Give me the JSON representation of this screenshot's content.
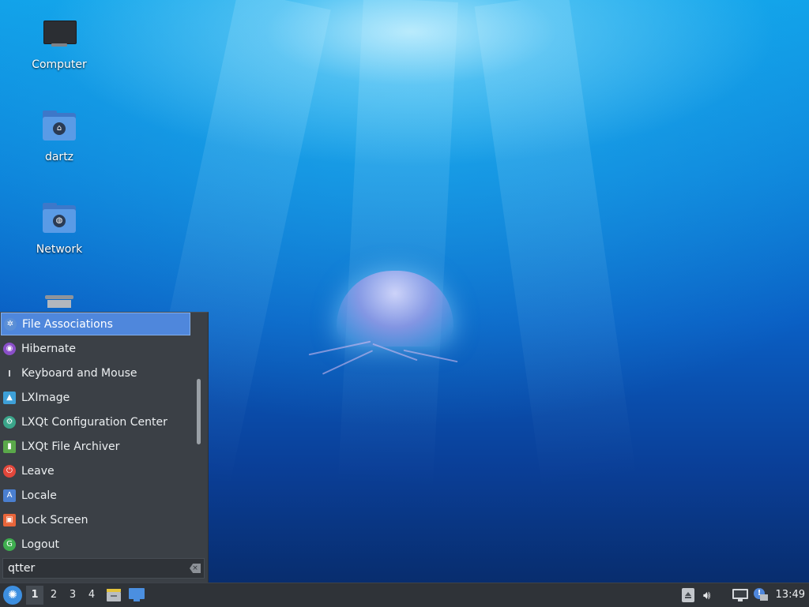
{
  "desktop": {
    "icons": [
      {
        "label": "Computer",
        "icon": "computer-icon"
      },
      {
        "label": "dartz",
        "icon": "home-folder-icon"
      },
      {
        "label": "Network",
        "icon": "network-folder-icon"
      },
      {
        "label": "",
        "icon": "trash-icon"
      }
    ]
  },
  "menu": {
    "items": [
      {
        "label": "File Associations",
        "icon": "file-associations-icon",
        "color": "#5b8fd6"
      },
      {
        "label": "Hibernate",
        "icon": "hibernate-icon",
        "color": "#8a4fc9"
      },
      {
        "label": "Keyboard and Mouse",
        "icon": "keyboard-mouse-icon",
        "color": "#2a2d31"
      },
      {
        "label": "LXImage",
        "icon": "lximage-icon",
        "color": "#3ea0d8"
      },
      {
        "label": "LXQt Configuration Center",
        "icon": "lxqt-config-icon",
        "color": "#3aa58a"
      },
      {
        "label": "LXQt File Archiver",
        "icon": "file-archiver-icon",
        "color": "#5aa84a"
      },
      {
        "label": "Leave",
        "icon": "power-icon",
        "color": "#e2473b"
      },
      {
        "label": "Locale",
        "icon": "locale-icon",
        "color": "#4a7fd0"
      },
      {
        "label": "Lock Screen",
        "icon": "lock-icon",
        "color": "#e8653a"
      },
      {
        "label": "Logout",
        "icon": "logout-icon",
        "color": "#3fae4f"
      }
    ],
    "selected_index": 0,
    "search": {
      "value": "qtter"
    }
  },
  "taskbar": {
    "desktops": [
      "1",
      "2",
      "3",
      "4"
    ],
    "active_desktop": "1",
    "clock": "13:49"
  },
  "colors": {
    "accent": "#4f87dc",
    "menu_bg": "#3b4046",
    "taskbar_bg": "#2f3338"
  }
}
